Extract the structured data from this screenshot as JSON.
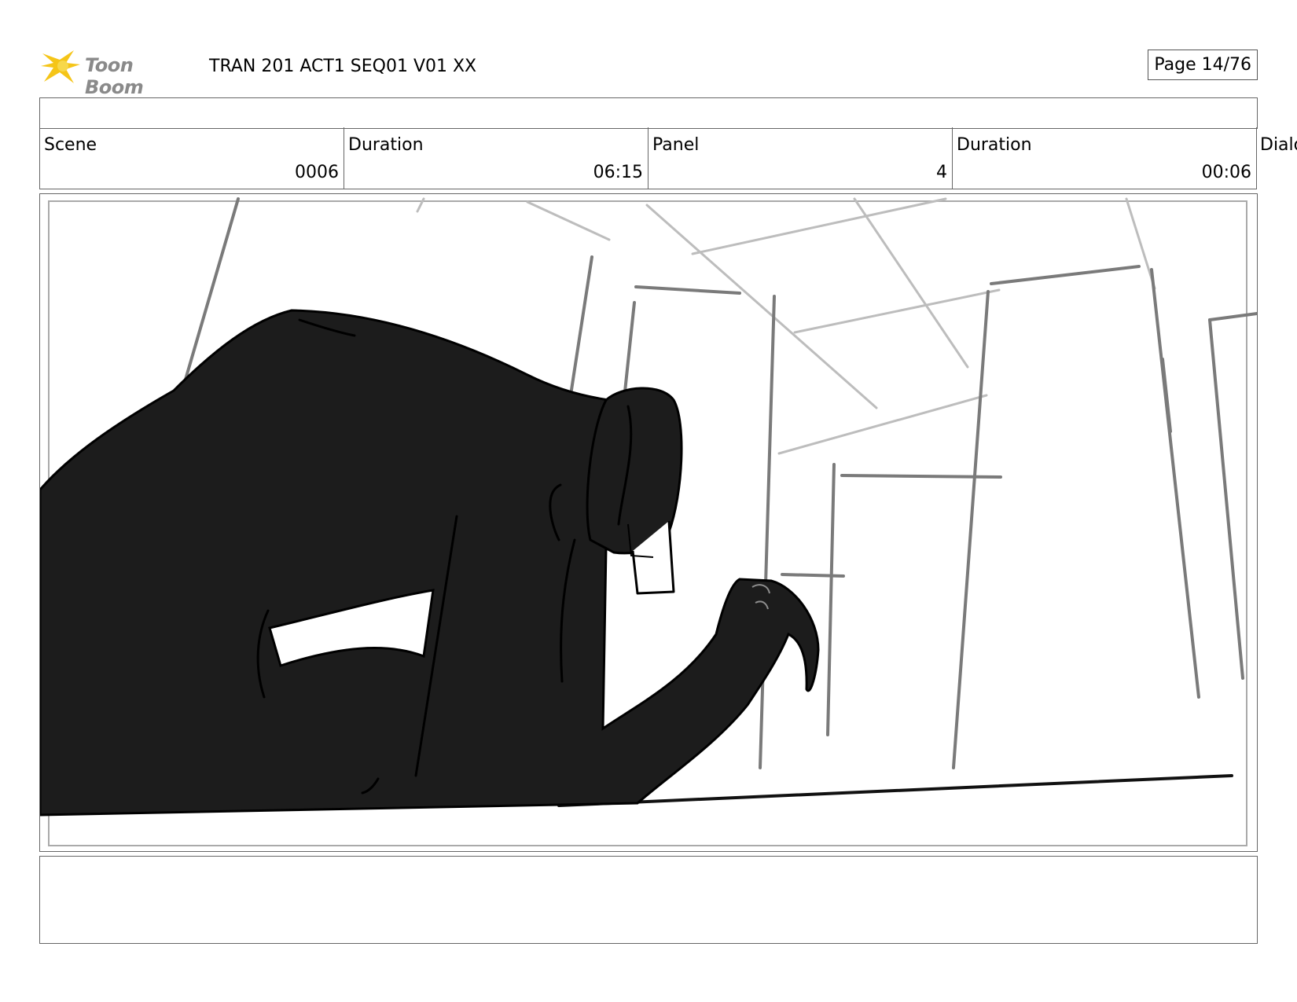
{
  "header": {
    "logo_text": "Toon Boom",
    "title": "TRAN 201 ACT1 SEQ01 V01 XX",
    "page": "Page 14/76"
  },
  "info": {
    "scene_label": "Scene",
    "scene_value": "0006",
    "scene_duration_label": "Duration",
    "scene_duration_value": "06:15",
    "panel_label": "Panel",
    "panel_value": "4",
    "panel_duration_label": "Duration",
    "panel_duration_value": "00:06",
    "dialog_label": "Dialo"
  },
  "colors": {
    "logo_yellow": "#f5c518",
    "logo_text": "#8a8a8a",
    "border": "#666666",
    "silhouette": "#1c1c1c"
  },
  "icons": {
    "logo": "toon-boom-star-logo"
  }
}
